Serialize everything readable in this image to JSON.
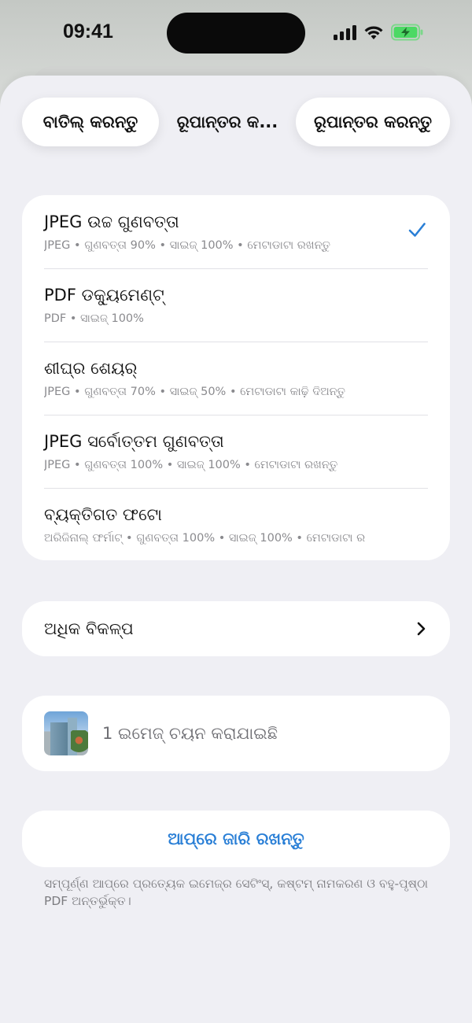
{
  "status_bar": {
    "time": "09:41"
  },
  "header": {
    "cancel_label": "ବାତିଲ୍ କରନ୍ତୁ",
    "title": "ରୂପାନ୍ତର କ...",
    "convert_label": "ରୂପାନ୍ତର କରନ୍ତୁ"
  },
  "presets": [
    {
      "title": "JPEG ଉଚ୍ଚ ଗୁଣବତ୍ତା",
      "subtitle": "JPEG • ଗୁଣବତ୍ତା 90% • ସାଇଜ୍ 100% • ମେଟାଡାଟା ରଖନ୍ତୁ",
      "selected": true
    },
    {
      "title": "PDF ଡକ୍ୟୁମେଣ୍ଟ୍",
      "subtitle": "PDF • ସାଇଜ୍ 100%",
      "selected": false
    },
    {
      "title": "ଶୀଘ୍ର ଶେୟର୍",
      "subtitle": "JPEG • ଗୁଣବତ୍ତା 70% • ସାଇଜ୍ 50% • ମେଟାଡାଟା କାଢ଼ି ଦିଅନ୍ତୁ",
      "selected": false
    },
    {
      "title": "JPEG ସର୍ବୋତ୍ତମ ଗୁଣବତ୍ତା",
      "subtitle": "JPEG • ଗୁଣବତ୍ତା 100% • ସାଇଜ୍ 100% • ମେଟାଡାଟା ରଖନ୍ତୁ",
      "selected": false
    },
    {
      "title": "ବ୍ୟକ୍ତିଗତ ଫଟୋ",
      "subtitle": "ଅରିଜିନାଲ୍ ଫର୍ମାଟ୍ • ଗୁଣବତ୍ତା 100% • ସାଇଜ୍ 100% • ମେଟାଡାଟା ର",
      "selected": false
    }
  ],
  "more_options": {
    "label": "ଅଧିକ ବିକଳ୍ପ"
  },
  "selection": {
    "label": "1 ଇମେଜ୍ ଚୟନ କରାଯାଇଛି"
  },
  "continue_in_app": {
    "label": "ଆପ୍‌ରେ ଜାରି ରଖନ୍ତୁ"
  },
  "footnote": "ସମ୍ପୂର୍ଣ୍ଣ ଆପ୍‌ରେ ପ୍ରତ୍ୟେକ ଇମେଜ୍‌ର ସେଟିଂସ୍, କଷ୍ଟମ୍ ନାମକରଣ ଓ ବହୁ-ପୃଷ୍ଠା PDF ଅନ୍ତର୍ଭୁକ୍ତ।",
  "colors": {
    "accent": "#2a7fd6",
    "check": "#2a7fd6",
    "battery": "#4cd964"
  }
}
